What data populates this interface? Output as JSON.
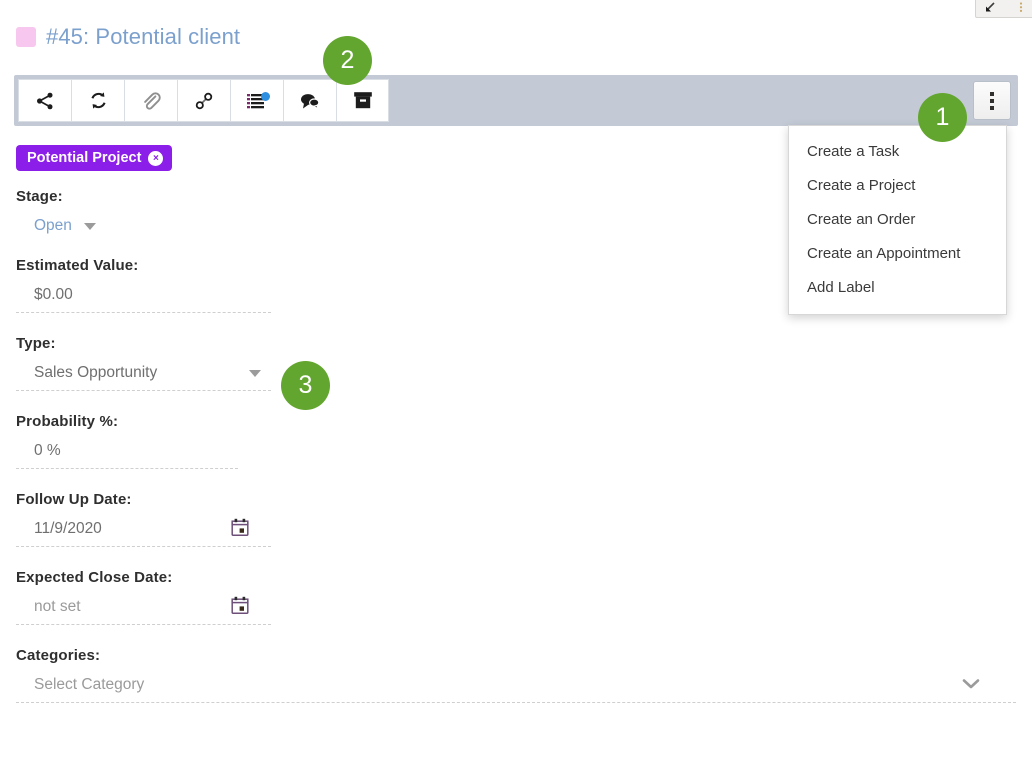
{
  "window": {
    "float_toolbar": {
      "icons": [
        "collapse-arrow-icon",
        "settings-dots-icon"
      ]
    }
  },
  "header": {
    "swatch_color": "#f7c7ef",
    "title": "#45: Potential client",
    "title_color": "#7ba0cd"
  },
  "toolbar": {
    "background": "#c3cad6",
    "buttons": [
      {
        "name": "share-icon",
        "tooltip": "Share"
      },
      {
        "name": "refresh-icon",
        "tooltip": "Refresh"
      },
      {
        "name": "paperclip-icon",
        "tooltip": "Attachments"
      },
      {
        "name": "link-icon",
        "tooltip": "Links"
      },
      {
        "name": "notes-list-icon",
        "tooltip": "Notes",
        "badge_dot": true,
        "dot_color": "#2f8fe0"
      },
      {
        "name": "comments-icon",
        "tooltip": "Comments"
      },
      {
        "name": "archive-icon",
        "tooltip": "Archive"
      }
    ],
    "overflow_button": "more-options-kebab"
  },
  "dropdown": {
    "open": true,
    "items": [
      "Create a Task",
      "Create a Project",
      "Create an Order",
      "Create an Appointment",
      "Add Label"
    ]
  },
  "label_chip": {
    "text": "Potential Project",
    "color": "#8b1ee8",
    "remove_label": "×"
  },
  "form": {
    "fields": [
      {
        "key": "stage",
        "label": "Stage:",
        "value": "Open",
        "control": "select",
        "value_color": "#7ba0cd",
        "underline": false
      },
      {
        "key": "estimated_value",
        "label": "Estimated Value:",
        "value": "$0.00",
        "control": "text",
        "underline": true
      },
      {
        "key": "type",
        "label": "Type:",
        "value": "Sales Opportunity",
        "control": "select",
        "underline": true
      },
      {
        "key": "probability",
        "label": "Probability %:",
        "value": "0 %",
        "control": "text",
        "underline": true
      },
      {
        "key": "follow_up_date",
        "label": "Follow Up Date:",
        "value": "11/9/2020",
        "control": "date",
        "underline": true
      },
      {
        "key": "expected_close_date",
        "label": "Expected Close Date:",
        "value": "not set",
        "control": "date",
        "underline": true
      },
      {
        "key": "categories",
        "label": "Categories:",
        "value": "Select Category",
        "control": "expand",
        "underline": true
      }
    ]
  },
  "annotations": {
    "color": "#63a62f",
    "badges": [
      {
        "id": "badge-1",
        "number": "1"
      },
      {
        "id": "badge-2",
        "number": "2"
      },
      {
        "id": "badge-3",
        "number": "3"
      }
    ]
  }
}
